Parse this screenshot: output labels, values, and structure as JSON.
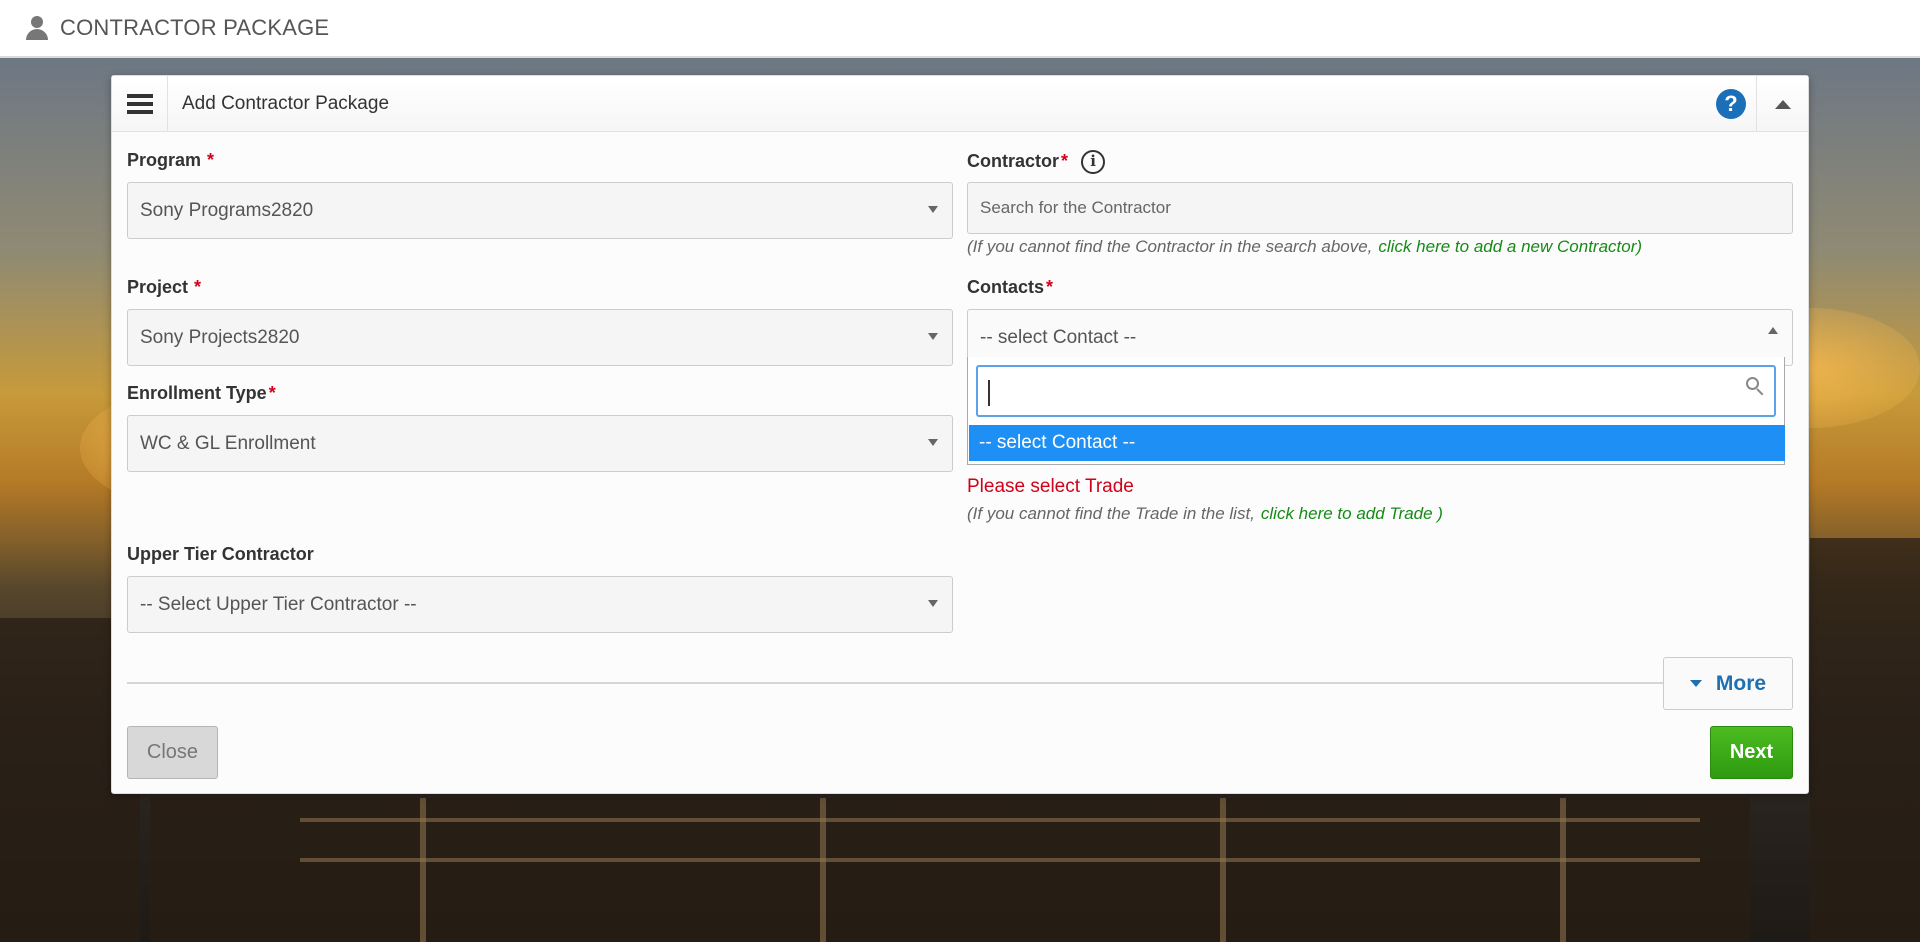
{
  "header": {
    "title": "CONTRACTOR PACKAGE"
  },
  "panel": {
    "title": "Add Contractor Package"
  },
  "form": {
    "program": {
      "label": "Program",
      "required_mark": "*",
      "value": "Sony Programs2820"
    },
    "project": {
      "label": "Project",
      "required_mark": "*",
      "value": "Sony Projects2820"
    },
    "enrollment_type": {
      "label": "Enrollment Type",
      "required_mark": "*",
      "value": "WC & GL Enrollment"
    },
    "upper_tier": {
      "label": "Upper Tier Contractor",
      "value": "-- Select Upper Tier Contractor --"
    },
    "contractor": {
      "label": "Contractor",
      "required_mark": "*",
      "info_glyph": "i",
      "placeholder": "Search for the Contractor",
      "hint": "(If you cannot find the Contractor in the search above,",
      "hint_link": "click here to add a new Contractor)"
    },
    "contacts": {
      "label": "Contacts",
      "required_mark": "*",
      "value": "-- select Contact --",
      "dropdown": {
        "search_value": "",
        "options": [
          "-- select Contact --"
        ]
      }
    },
    "trade": {
      "error": "Please select Trade",
      "hint": "(If you cannot find the Trade in the list,",
      "hint_link": "click here to add Trade )"
    }
  },
  "actions": {
    "more_label": "More",
    "close_label": "Close",
    "next_label": "Next"
  },
  "colors": {
    "accent_blue": "#1e90f5",
    "link_green": "#168a16",
    "error_red": "#d0021b",
    "next_green": "#3aab18"
  },
  "icons": {
    "user": "user-icon",
    "menu": "hamburger-menu-icon",
    "help": "help-icon",
    "collapse": "collapse-up-icon",
    "search": "search-icon",
    "info": "info-icon"
  }
}
